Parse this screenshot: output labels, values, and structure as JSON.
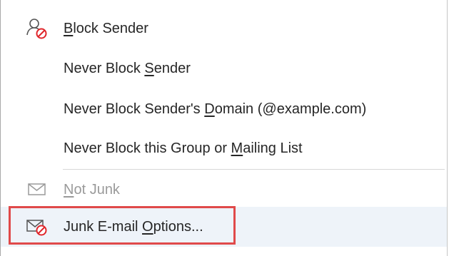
{
  "menu": {
    "items": [
      {
        "id": "block-sender",
        "pre": "",
        "accel": "B",
        "post": "lock Sender",
        "icon": "block-person-icon",
        "enabled": true
      },
      {
        "id": "never-block-sender",
        "pre": "Never Block ",
        "accel": "S",
        "post": "ender",
        "icon": "",
        "enabled": true
      },
      {
        "id": "never-block-domain",
        "pre": "Never Block Sender's ",
        "accel": "D",
        "post": "omain (@example.com)",
        "icon": "",
        "enabled": true
      },
      {
        "id": "never-block-group",
        "pre": "Never Block this Group or ",
        "accel": "M",
        "post": "ailing List",
        "icon": "",
        "enabled": true
      },
      {
        "id": "not-junk",
        "pre": "",
        "accel": "N",
        "post": "ot Junk",
        "icon": "envelope-icon",
        "enabled": false
      },
      {
        "id": "junk-email-options",
        "pre": "Junk E-mail ",
        "accel": "O",
        "post": "ptions...",
        "icon": "envelope-block-icon",
        "enabled": true,
        "highlighted": true
      }
    ]
  },
  "colors": {
    "highlight_bg": "#eef3f9",
    "focus_border": "#e04a4a",
    "block_red": "#e0262b",
    "disabled_text": "#9a9a9a"
  }
}
